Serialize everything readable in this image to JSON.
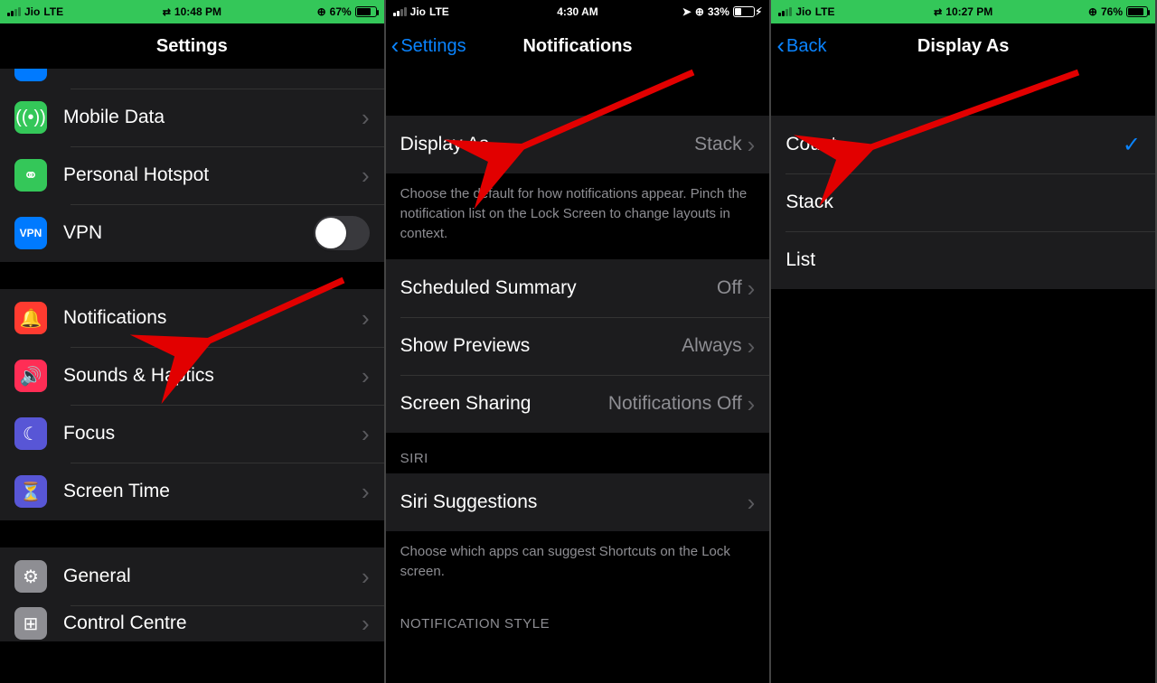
{
  "screen1": {
    "status": {
      "carrier": "Jio",
      "network": "LTE",
      "time": "10:48 PM",
      "battery_pct": "67%"
    },
    "title": "Settings",
    "rows": {
      "mobile_data": "Mobile Data",
      "personal_hotspot": "Personal Hotspot",
      "vpn": "VPN",
      "notifications": "Notifications",
      "sounds": "Sounds & Haptics",
      "focus": "Focus",
      "screen_time": "Screen Time",
      "general": "General",
      "control_centre": "Control Centre"
    }
  },
  "screen2": {
    "status": {
      "carrier": "Jio",
      "network": "LTE",
      "time": "4:30 AM",
      "battery_pct": "33%"
    },
    "back": "Settings",
    "title": "Notifications",
    "rows": {
      "display_as": {
        "label": "Display As",
        "value": "Stack"
      },
      "display_as_footer": "Choose the default for how notifications appear. Pinch the notification list on the Lock Screen to change layouts in context.",
      "scheduled_summary": {
        "label": "Scheduled Summary",
        "value": "Off"
      },
      "show_previews": {
        "label": "Show Previews",
        "value": "Always"
      },
      "screen_sharing": {
        "label": "Screen Sharing",
        "value": "Notifications Off"
      },
      "siri_header": "SIRI",
      "siri_suggestions": "Siri Suggestions",
      "siri_footer": "Choose which apps can suggest Shortcuts on the Lock screen.",
      "notif_style_header": "NOTIFICATION STYLE"
    }
  },
  "screen3": {
    "status": {
      "carrier": "Jio",
      "network": "LTE",
      "time": "10:27 PM",
      "battery_pct": "76%"
    },
    "back": "Back",
    "title": "Display As",
    "options": {
      "count": "Count",
      "stack": "Stack",
      "list": "List"
    },
    "selected": "count"
  }
}
